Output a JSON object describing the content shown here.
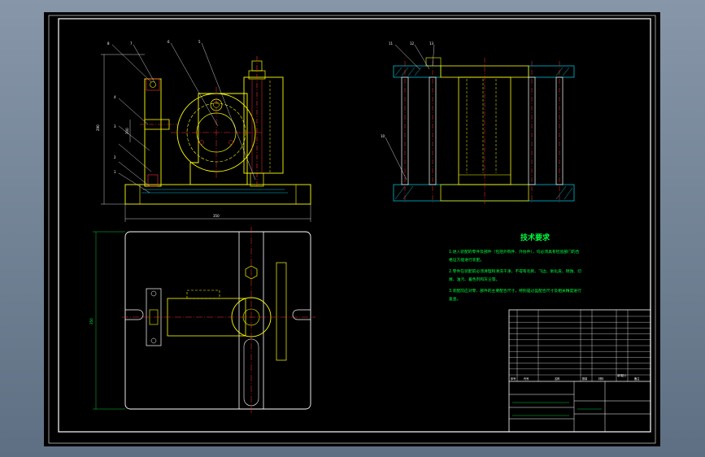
{
  "colors": {
    "background": "#000000",
    "frame": "#ffffff",
    "part": "#ffff00",
    "hidden": "#ffff00",
    "center": "#ff3333",
    "hatch": "#00bcd4",
    "dim": "#ffffff",
    "text": "#00ff40",
    "leader": "#ffffff"
  },
  "front_view": {
    "balloons": [
      "8",
      "7",
      "6",
      "5",
      "4",
      "3",
      "2",
      "1"
    ],
    "dims": {
      "width": "350",
      "height": "290",
      "side": "200"
    }
  },
  "side_view": {
    "balloons": [
      "11",
      "12",
      "13",
      "10"
    ]
  },
  "top_view": {
    "dims": {
      "height": "350"
    }
  },
  "tech_req": {
    "title": "技术要求",
    "lines": [
      "1.进入装配的零件及部件（包括外购件、外协件），均必须具有检验部门的合",
      "格证方能进行装配。",
      "2.零件在装配前必须清理和清洗干净，不得有毛刺、飞边、氧化皮、锈蚀、切",
      "屑、油污、着色剂和灰尘等。",
      "3.装配前应对零、部件的主要配合尺寸，特别是过盈配合尺寸及相关精度进行",
      "复查。"
    ]
  },
  "title_block": {
    "col_headers": [
      "序号",
      "代号",
      "名称",
      "数量",
      "材料",
      "单件",
      "总计",
      "备注"
    ]
  }
}
